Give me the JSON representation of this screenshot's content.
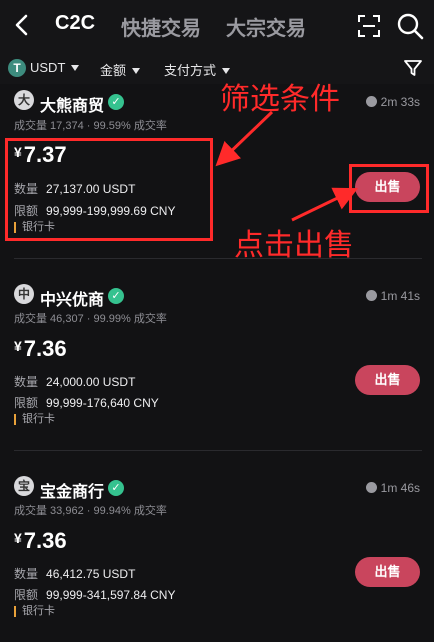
{
  "header": {
    "tabs": [
      {
        "label": "C2C",
        "active": true
      },
      {
        "label": "快捷交易",
        "active": false
      },
      {
        "label": "大宗交易",
        "active": false
      }
    ]
  },
  "filters": {
    "coin_glyph": "T",
    "coin": "USDT",
    "amount": "金额",
    "payment": "支付方式"
  },
  "listings": [
    {
      "avatar": "大",
      "name": "大熊商贸",
      "timer": "2m 33s",
      "volume": "成交量 17,374",
      "rate": "99.59% 成交率",
      "currency": "¥",
      "price": "7.37",
      "qty_label": "数量",
      "qty": "27,137.00 USDT",
      "limit_label": "限额",
      "limit": "99,999-199,999.69 CNY",
      "payment": "银行卡",
      "action": "出售"
    },
    {
      "avatar": "中",
      "name": "中兴优商",
      "timer": "1m 41s",
      "volume": "成交量 46,307",
      "rate": "99.99% 成交率",
      "currency": "¥",
      "price": "7.36",
      "qty_label": "数量",
      "qty": "24,000.00 USDT",
      "limit_label": "限额",
      "limit": "99,999-176,640 CNY",
      "payment": "银行卡",
      "action": "出售"
    },
    {
      "avatar": "宝",
      "name": "宝金商行",
      "timer": "1m 46s",
      "volume": "成交量 33,962",
      "rate": "99.94% 成交率",
      "currency": "¥",
      "price": "7.36",
      "qty_label": "数量",
      "qty": "46,412.75 USDT",
      "limit_label": "限额",
      "limit": "99,999-341,597.84 CNY",
      "payment": "银行卡",
      "action": "出售"
    }
  ],
  "annotations": {
    "filter_note": "筛选条件",
    "sell_note": "点击出售",
    "color": "#ff2a2a"
  },
  "colors": {
    "sell_button": "#c9455d",
    "verified": "#35c28f",
    "coin": "#3d8c7e"
  }
}
